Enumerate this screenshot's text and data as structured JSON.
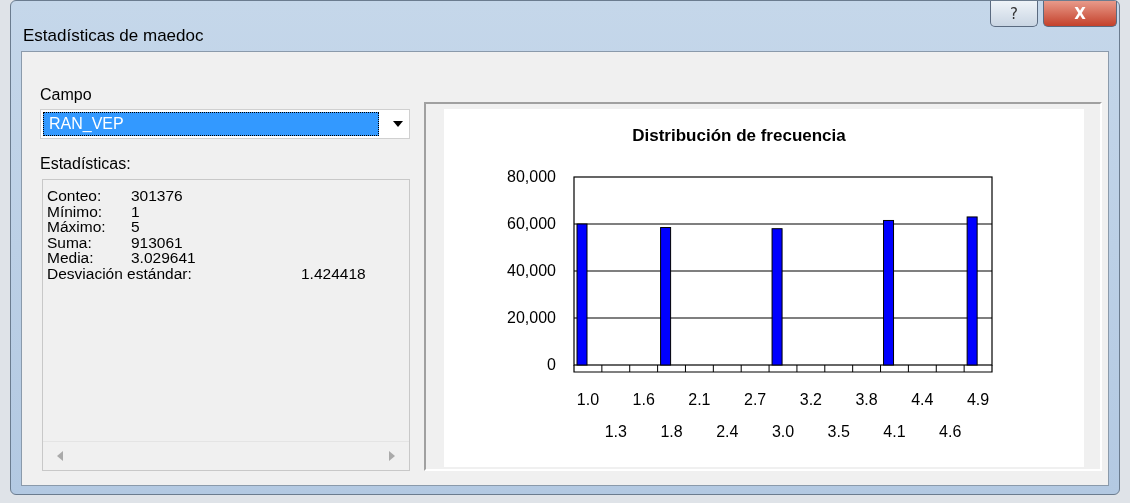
{
  "window": {
    "title": "Estadísticas de maedoc",
    "help_button": "?",
    "close_button": "X"
  },
  "field": {
    "label": "Campo",
    "value": "RAN_VEP"
  },
  "statistics": {
    "label": "Estadísticas:",
    "rows": [
      {
        "kind": "short",
        "label": "Conteo:",
        "value": "301376"
      },
      {
        "kind": "short",
        "label": "Mínimo:",
        "value": "1"
      },
      {
        "kind": "short",
        "label": "Máximo:",
        "value": "5"
      },
      {
        "kind": "short",
        "label": "Suma:",
        "value": "913061"
      },
      {
        "kind": "short",
        "label": "Media:",
        "value": "3.029641"
      },
      {
        "kind": "long",
        "label": "Desviación estándar:",
        "value": "1.424418"
      }
    ]
  },
  "chart_data": {
    "type": "bar",
    "title": "Distribución de frecuencia",
    "categories": [
      "1.0",
      "1.3",
      "1.6",
      "1.8",
      "2.1",
      "2.4",
      "2.7",
      "3.0",
      "3.2",
      "3.5",
      "3.8",
      "4.1",
      "4.4",
      "4.6",
      "4.9"
    ],
    "series": [
      {
        "color": "#0000ff",
        "values": [
          60000,
          0,
          0,
          58500,
          0,
          0,
          0,
          58000,
          0,
          0,
          0,
          61500,
          0,
          0,
          63000
        ]
      }
    ],
    "ylim": [
      0,
      80000
    ],
    "grid": true,
    "yticks": [
      {
        "value": 0,
        "label": "0"
      },
      {
        "value": 20000,
        "label": "20,000"
      },
      {
        "value": 40000,
        "label": "40,000"
      },
      {
        "value": 60000,
        "label": "60,000"
      },
      {
        "value": 80000,
        "label": "80,000"
      }
    ]
  }
}
